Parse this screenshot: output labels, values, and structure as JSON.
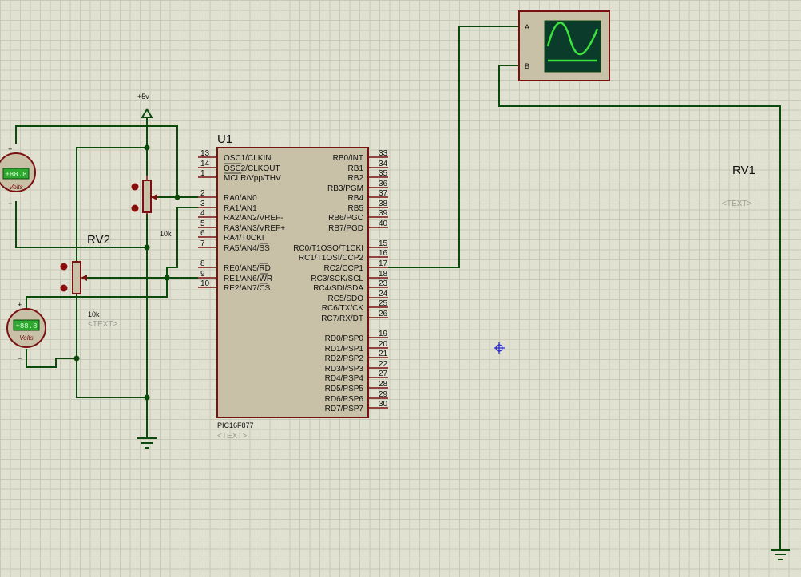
{
  "colors": {
    "background": "#e1e1d2",
    "wire": "#0b4a0b",
    "component_outline": "#7a1010",
    "ic_body": "#c8c1a8",
    "scope_screen": "#0b3b2b",
    "scope_trace": "#3be33b",
    "meter_lcd": "#2ea82e"
  },
  "u1": {
    "ref": "U1",
    "part": "PIC16F877",
    "text_placeholder": "<TEXT>",
    "left_pins": [
      {
        "num": "13",
        "name": "OSC1/CLKIN"
      },
      {
        "num": "14",
        "name": "OSC2/CLKOUT"
      },
      {
        "num": "1",
        "name": "MCLR/Vpp/THV"
      },
      {
        "num": "2",
        "name": "RA0/AN0"
      },
      {
        "num": "3",
        "name": "RA1/AN1"
      },
      {
        "num": "4",
        "name": "RA2/AN2/VREF-"
      },
      {
        "num": "5",
        "name": "RA3/AN3/VREF+"
      },
      {
        "num": "6",
        "name": "RA4/T0CKI"
      },
      {
        "num": "7",
        "name": "RA5/AN4/SS"
      },
      {
        "num": "8",
        "name": "RE0/AN5/RD"
      },
      {
        "num": "9",
        "name": "RE1/AN6/WR"
      },
      {
        "num": "10",
        "name": "RE2/AN7/CS"
      }
    ],
    "right_pins": [
      {
        "num": "33",
        "name": "RB0/INT"
      },
      {
        "num": "34",
        "name": "RB1"
      },
      {
        "num": "35",
        "name": "RB2"
      },
      {
        "num": "36",
        "name": "RB3/PGM"
      },
      {
        "num": "37",
        "name": "RB4"
      },
      {
        "num": "38",
        "name": "RB5"
      },
      {
        "num": "39",
        "name": "RB6/PGC"
      },
      {
        "num": "40",
        "name": "RB7/PGD"
      },
      {
        "num": "15",
        "name": "RC0/T1OSO/T1CKI"
      },
      {
        "num": "16",
        "name": "RC1/T1OSI/CCP2"
      },
      {
        "num": "17",
        "name": "RC2/CCP1"
      },
      {
        "num": "18",
        "name": "RC3/SCK/SCL"
      },
      {
        "num": "23",
        "name": "RC4/SDI/SDA"
      },
      {
        "num": "24",
        "name": "RC5/SDO"
      },
      {
        "num": "25",
        "name": "RC6/TX/CK"
      },
      {
        "num": "26",
        "name": "RC7/RX/DT"
      },
      {
        "num": "19",
        "name": "RD0/PSP0"
      },
      {
        "num": "20",
        "name": "RD1/PSP1"
      },
      {
        "num": "21",
        "name": "RD2/PSP2"
      },
      {
        "num": "22",
        "name": "RD3/PSP3"
      },
      {
        "num": "27",
        "name": "RD4/PSP4"
      },
      {
        "num": "28",
        "name": "RD5/PSP5"
      },
      {
        "num": "29",
        "name": "RD6/PSP6"
      },
      {
        "num": "30",
        "name": "RD7/PSP7"
      }
    ]
  },
  "power": {
    "label": "+5v"
  },
  "pot_upper": {
    "value": "10k"
  },
  "rv2": {
    "ref": "RV2",
    "value": "10k",
    "text_placeholder": "<TEXT>"
  },
  "rv1": {
    "ref": "RV1",
    "text_placeholder": "<TEXT>"
  },
  "voltmeters": [
    {
      "reading": "+88.8",
      "unit": "Volts",
      "plus": "+",
      "minus": "−"
    },
    {
      "reading": "+88.8",
      "unit": "Volts",
      "plus": "+",
      "minus": "−"
    }
  ],
  "oscilloscope": {
    "channel_a": "A",
    "channel_b": "B"
  }
}
